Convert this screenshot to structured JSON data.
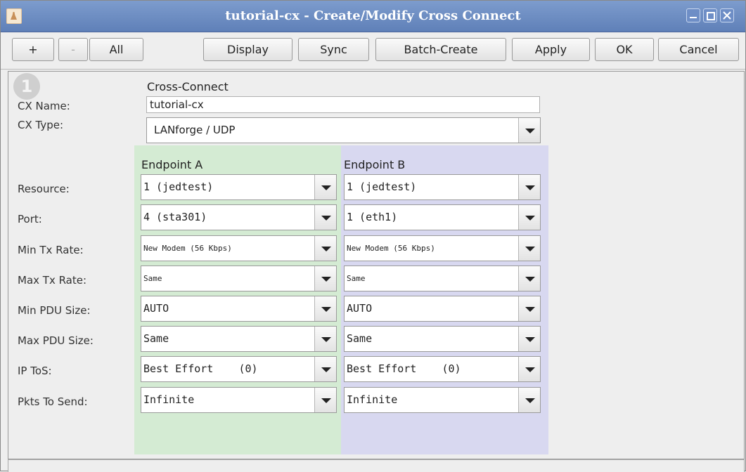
{
  "window": {
    "title": "tutorial-cx - Create/Modify Cross Connect"
  },
  "toolbar": {
    "add_label": "+",
    "remove_label": "-",
    "all_label": "All",
    "display_label": "Display",
    "sync_label": "Sync",
    "batch_create_label": "Batch-Create",
    "apply_label": "Apply",
    "ok_label": "OK",
    "cancel_label": "Cancel"
  },
  "form": {
    "step_badge": "1",
    "section_title": "Cross-Connect",
    "cx_name_label": "CX Name:",
    "cx_name_value": "tutorial-cx",
    "cx_type_label": "CX Type:",
    "cx_type_value": "LANforge / UDP",
    "endpoint_a_title": "Endpoint A",
    "endpoint_b_title": "Endpoint B",
    "row_labels": {
      "resource": "Resource:",
      "port": "Port:",
      "min_tx_rate": "Min Tx Rate:",
      "max_tx_rate": "Max Tx Rate:",
      "min_pdu_size": "Min PDU Size:",
      "max_pdu_size": "Max PDU Size:",
      "ip_tos": "IP ToS:",
      "pkts_to_send": "Pkts To Send:"
    },
    "endpoint_a": {
      "resource": "1 (jedtest)",
      "port": "4 (sta301)",
      "min_tx_rate": "New Modem (56 Kbps)",
      "max_tx_rate": "Same",
      "min_pdu_size": "AUTO",
      "max_pdu_size": "Same",
      "ip_tos": "Best Effort    (0)",
      "pkts_to_send": "Infinite"
    },
    "endpoint_b": {
      "resource": "1 (jedtest)",
      "port": "1 (eth1)",
      "min_tx_rate": "New Modem (56 Kbps)",
      "max_tx_rate": "Same",
      "min_pdu_size": "AUTO",
      "max_pdu_size": "Same",
      "ip_tos": "Best Effort    (0)",
      "pkts_to_send": "Infinite"
    }
  }
}
